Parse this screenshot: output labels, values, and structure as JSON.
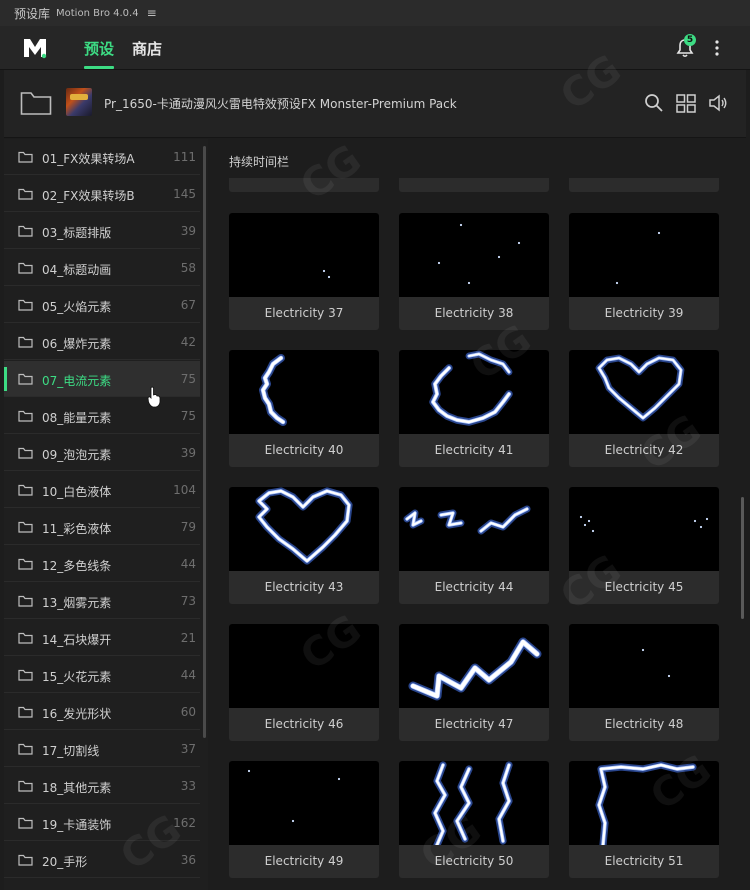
{
  "titlebar": {
    "title": "预设库",
    "app": "Motion Bro 4.0.4",
    "menu_glyph": "≡"
  },
  "header": {
    "tabs": [
      {
        "label": "预设",
        "active": true
      },
      {
        "label": "商店",
        "active": false
      }
    ],
    "notification_count": "5",
    "accent": "#3ddc84"
  },
  "pack": {
    "name": "Pr_1650-卡通动漫风火雷电特效预设FX Monster-Premium Pack"
  },
  "categories": [
    {
      "label": "01_FX效果转场A",
      "count": "111"
    },
    {
      "label": "02_FX效果转场B",
      "count": "145"
    },
    {
      "label": "03_标题排版",
      "count": "39"
    },
    {
      "label": "04_标题动画",
      "count": "58"
    },
    {
      "label": "05_火焰元素",
      "count": "67"
    },
    {
      "label": "06_爆炸元素",
      "count": "42"
    },
    {
      "label": "07_电流元素",
      "count": "75",
      "active": true
    },
    {
      "label": "08_能量元素",
      "count": "75"
    },
    {
      "label": "09_泡泡元素",
      "count": "39"
    },
    {
      "label": "10_白色液体",
      "count": "104"
    },
    {
      "label": "11_彩色液体",
      "count": "79"
    },
    {
      "label": "12_多色线条",
      "count": "44"
    },
    {
      "label": "13_烟雾元素",
      "count": "73"
    },
    {
      "label": "14_石块爆开",
      "count": "21"
    },
    {
      "label": "15_火花元素",
      "count": "44"
    },
    {
      "label": "16_发光形状",
      "count": "60"
    },
    {
      "label": "17_切割线",
      "count": "37"
    },
    {
      "label": "18_其他元素",
      "count": "33"
    },
    {
      "label": "19_卡通装饰",
      "count": "162"
    },
    {
      "label": "20_手形",
      "count": "36"
    }
  ],
  "main": {
    "section_title": "持续时间栏",
    "presets": [
      "Electricity 37",
      "Electricity 38",
      "Electricity 39",
      "Electricity 40",
      "Electricity 41",
      "Electricity 42",
      "Electricity 43",
      "Electricity 44",
      "Electricity 45",
      "Electricity 46",
      "Electricity 47",
      "Electricity 48",
      "Electricity 49",
      "Electricity 50",
      "Electricity 51"
    ]
  },
  "watermark": "CG"
}
